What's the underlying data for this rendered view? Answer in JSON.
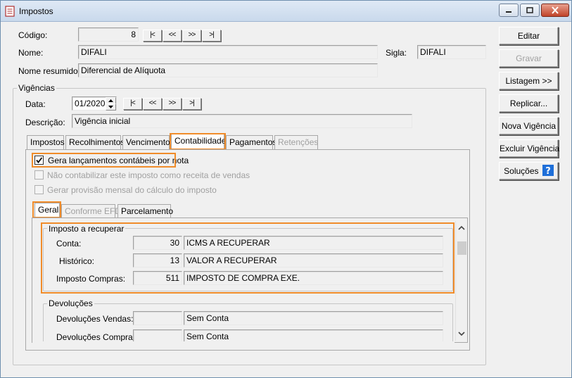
{
  "window": {
    "title": "Impostos"
  },
  "form": {
    "codigo_label": "Código:",
    "codigo_value": "8",
    "nav": [
      "|<",
      "<<",
      ">>",
      ">|"
    ],
    "nome_label": "Nome:",
    "nome_value": "DIFALI",
    "sigla_label": "Sigla:",
    "sigla_value": "DIFALI",
    "nome_resumido_label": "Nome resumido:",
    "nome_resumido_value": "Diferencial de Alíquota"
  },
  "vigencias": {
    "title": "Vigências",
    "data_label": "Data:",
    "data_value": "01/2020",
    "nav": [
      "|<",
      "<<",
      ">>",
      ">|"
    ],
    "descricao_label": "Descrição:",
    "descricao_value": "Vigência inicial"
  },
  "tabs": [
    "Impostos",
    "Recolhimentos",
    "Vencimento",
    "Contabilidade",
    "Pagamentos",
    "Retenções"
  ],
  "contabilidade": {
    "check1": "Gera lançamentos contábeis por nota",
    "check2": "Não contabilizar este imposto como receita de vendas",
    "check3": "Gerar provisão mensal do cálculo do imposto",
    "subtabs": [
      "Geral",
      "Conforme EFD",
      "Parcelamento"
    ],
    "imposto_recuperar": {
      "title": "Imposto a recuperar",
      "rows": [
        {
          "label": "Conta:",
          "code": "30",
          "desc": "ICMS A RECUPERAR"
        },
        {
          "label": "Histórico:",
          "code": "13",
          "desc": "VALOR A RECUPERAR"
        },
        {
          "label": "Imposto Compras:",
          "code": "511",
          "desc": "IMPOSTO DE COMPRA EXE."
        }
      ]
    },
    "devolucoes": {
      "title": "Devoluções",
      "rows": [
        {
          "label": "Devoluções Vendas:",
          "code": "",
          "desc": "Sem Conta"
        },
        {
          "label": "Devoluções Compras:",
          "code": "",
          "desc": "Sem Conta"
        }
      ]
    }
  },
  "buttons": {
    "editar": "Editar",
    "gravar": "Gravar",
    "listagem": "Listagem >>",
    "replicar": "Replicar...",
    "nova_vigencia": "Nova Vigência",
    "excluir_vigencia": "Excluir Vigência",
    "solucoes": "Soluções"
  },
  "colors": {
    "highlight": "#f08c2a",
    "help": "#1e6fd9"
  }
}
